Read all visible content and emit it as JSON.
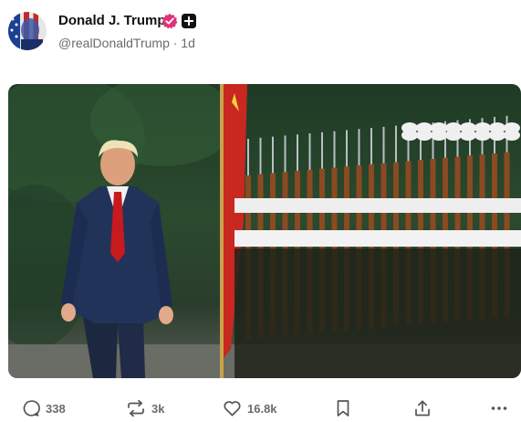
{
  "post": {
    "author": {
      "display_name": "Donald J. Trump",
      "handle_line": "@realDonaldTrump · 1d",
      "verified_color": "#e3307a"
    },
    "media": {
      "alt": "Man in navy suit and red tie walking past a line of uniformed honor guard soldiers holding rifles with bayonets"
    },
    "actions": {
      "replies": "338",
      "reposts": "3k",
      "likes": "16.8k"
    }
  },
  "icons": {
    "verified": "verified-badge-icon",
    "plus_badge": "plus-badge-icon",
    "reply": "comment-bubble-icon",
    "repost": "repost-arrows-icon",
    "like": "heart-icon",
    "bookmark": "bookmark-icon",
    "share": "share-upload-icon",
    "more": "more-dots-icon"
  }
}
